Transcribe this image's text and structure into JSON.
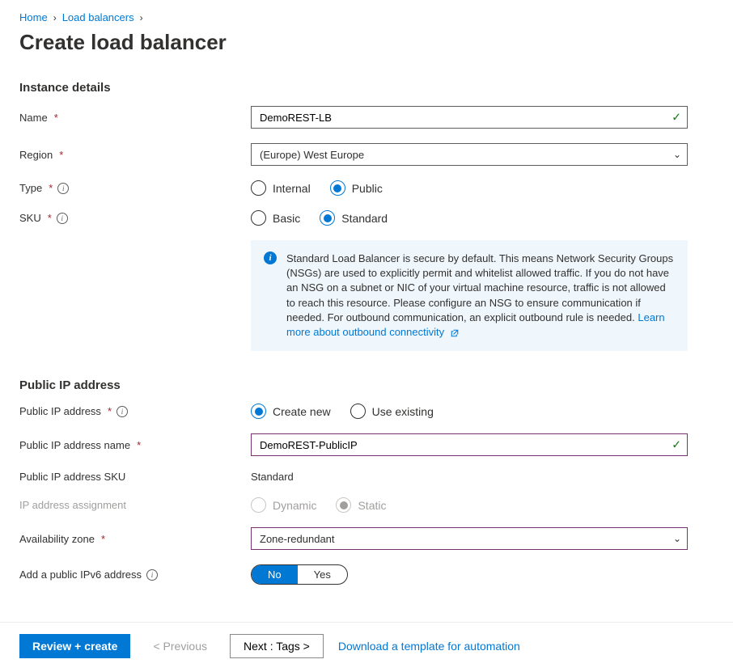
{
  "breadcrumb": {
    "home": "Home",
    "load_balancers": "Load balancers"
  },
  "title": "Create load balancer",
  "sections": {
    "instance": {
      "heading": "Instance details",
      "name_label": "Name",
      "name_value": "DemoREST-LB",
      "region_label": "Region",
      "region_value": "(Europe) West Europe",
      "type_label": "Type",
      "type_options": {
        "internal": "Internal",
        "public": "Public"
      },
      "type_selected": "public",
      "sku_label": "SKU",
      "sku_options": {
        "basic": "Basic",
        "standard": "Standard"
      },
      "sku_selected": "standard",
      "info_text": "Standard Load Balancer is secure by default.  This means Network Security Groups (NSGs) are used to explicitly permit and whitelist allowed traffic. If you do not have an NSG on a subnet or NIC of your virtual machine resource, traffic is not allowed to reach this resource. Please configure an NSG to ensure communication if needed.  For outbound communication, an explicit outbound rule is needed.",
      "info_link": "Learn more about outbound connectivity"
    },
    "publicip": {
      "heading": "Public IP address",
      "pip_label": "Public IP address",
      "pip_options": {
        "create": "Create new",
        "existing": "Use existing"
      },
      "pip_selected": "create",
      "pip_name_label": "Public IP address name",
      "pip_name_value": "DemoREST-PublicIP",
      "pip_sku_label": "Public IP address SKU",
      "pip_sku_value": "Standard",
      "assign_label": "IP address assignment",
      "assign_options": {
        "dynamic": "Dynamic",
        "static": "Static"
      },
      "assign_selected": "static",
      "zone_label": "Availability zone",
      "zone_value": "Zone-redundant",
      "ipv6_label": "Add a public IPv6 address",
      "ipv6_options": {
        "no": "No",
        "yes": "Yes"
      },
      "ipv6_selected": "no"
    }
  },
  "footer": {
    "review": "Review + create",
    "previous": "< Previous",
    "next": "Next : Tags >",
    "download": "Download a template for automation"
  }
}
